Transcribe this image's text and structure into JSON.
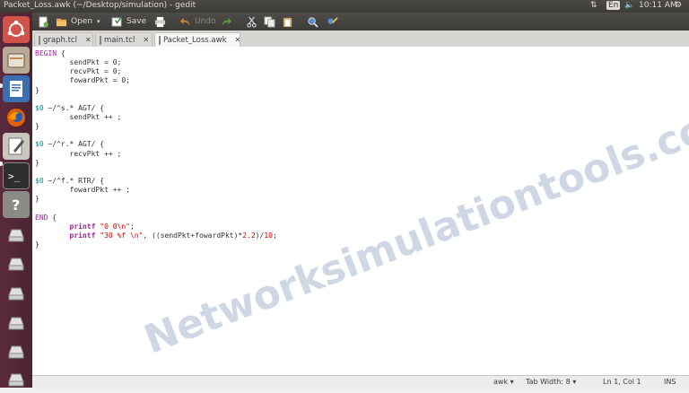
{
  "window": {
    "title": "Packet_Loss.awk (~/Desktop/simulation) - gedit"
  },
  "top_panel": {
    "keyboard": "En",
    "time": "10:11 AM"
  },
  "toolbar": {
    "open_label": "Open",
    "save_label": "Save",
    "undo_label": "Undo"
  },
  "tabs": [
    {
      "label": "graph.tcl"
    },
    {
      "label": "main.tcl"
    },
    {
      "label": "Packet_Loss.awk"
    }
  ],
  "code_lines": [
    [
      {
        "t": "BEGIN",
        "c": "kw"
      },
      {
        "t": " {",
        "c": ""
      }
    ],
    [
      {
        "t": "        sendPkt = 0;",
        "c": ""
      }
    ],
    [
      {
        "t": "        recvPkt = 0;",
        "c": ""
      }
    ],
    [
      {
        "t": "        fowardPkt = 0;",
        "c": ""
      }
    ],
    [
      {
        "t": "}",
        "c": ""
      }
    ],
    [],
    [
      {
        "t": "$0",
        "c": "var"
      },
      {
        "t": " ~/^s.* AGT/ {",
        "c": ""
      }
    ],
    [
      {
        "t": "        sendPkt ++ ;",
        "c": ""
      }
    ],
    [
      {
        "t": "}",
        "c": ""
      }
    ],
    [],
    [
      {
        "t": "$0",
        "c": "var"
      },
      {
        "t": " ~/^r.* AGT/ {",
        "c": ""
      }
    ],
    [
      {
        "t": "        recvPkt ++ ;",
        "c": ""
      }
    ],
    [
      {
        "t": "}",
        "c": ""
      }
    ],
    [],
    [
      {
        "t": "$0",
        "c": "var"
      },
      {
        "t": " ~/^f.* RTR/ {",
        "c": ""
      }
    ],
    [
      {
        "t": "        fowardPkt ++ ;",
        "c": ""
      }
    ],
    [
      {
        "t": "}",
        "c": ""
      }
    ],
    [],
    [
      {
        "t": "END",
        "c": "kw"
      },
      {
        "t": " {",
        "c": ""
      }
    ],
    [
      {
        "t": "        ",
        "c": ""
      },
      {
        "t": "printf",
        "c": "fn"
      },
      {
        "t": " ",
        "c": ""
      },
      {
        "t": "\"0 0\\n\"",
        "c": "str"
      },
      {
        "t": ";",
        "c": ""
      }
    ],
    [
      {
        "t": "        ",
        "c": ""
      },
      {
        "t": "printf",
        "c": "fn"
      },
      {
        "t": " ",
        "c": ""
      },
      {
        "t": "\"30 %f \\n\"",
        "c": "str"
      },
      {
        "t": ", ((sendPkt+fowardPkt)*",
        "c": ""
      },
      {
        "t": "2.2",
        "c": "num"
      },
      {
        "t": ")/",
        "c": ""
      },
      {
        "t": "10",
        "c": "num"
      },
      {
        "t": ";",
        "c": ""
      }
    ],
    [
      {
        "t": "}",
        "c": ""
      }
    ]
  ],
  "watermark": "Networksimulationtools.com",
  "statusbar": {
    "language": "awk",
    "tab_width": "Tab Width: 8",
    "position": "Ln 1, Col 1",
    "mode": "INS"
  },
  "colors": {
    "keyword": "#a020a0",
    "variable": "#008a8c",
    "string": "#d00000",
    "launcher": "#5a2a3c"
  }
}
